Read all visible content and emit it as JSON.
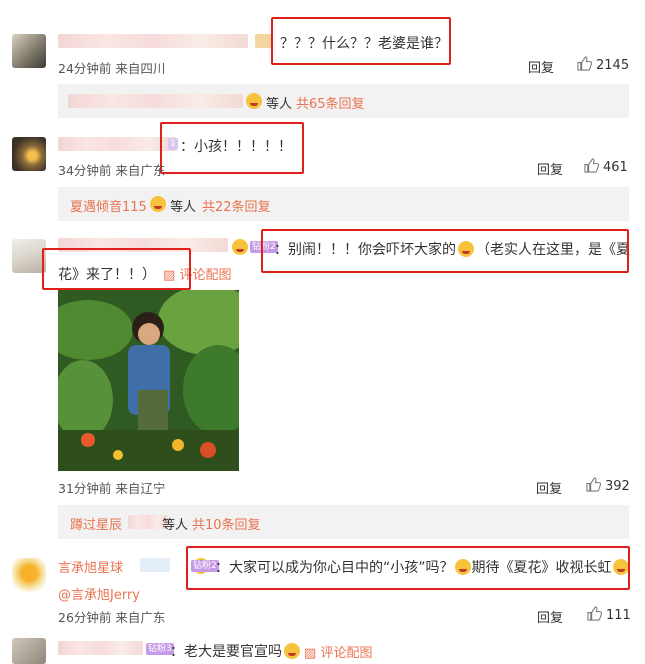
{
  "comments": [
    {
      "text": "？？？什么？？老婆是谁？",
      "meta": "24分钟前 来自四川",
      "reply": "回复",
      "likes": "2145",
      "sub": {
        "text": "等人",
        "count": "共65条回复"
      }
    },
    {
      "text": "：小孩！！！！！",
      "meta": "34分钟前 来自广东",
      "reply": "回复",
      "likes": "461",
      "sub": {
        "user": "夏遇倾音115",
        "text": "等人",
        "count": "共22条回复"
      }
    },
    {
      "badge": "钻粉2",
      "text": "：别闹！！！你会吓坏大家的",
      "text2": "（老实人在这里，是《夏",
      "text3": "花》来了！！）",
      "pic": "评论配图",
      "meta": "31分钟前 来自辽宁",
      "reply": "回复",
      "likes": "392",
      "sub": {
        "user": "蹲过星辰",
        "text": "等人",
        "count": "共10条回复"
      }
    },
    {
      "user": "言承旭星球",
      "badge": "钻粉2",
      "text": "：大家可以成为你心目中的“小孩”吗？",
      "text2": "期待《夏花》收视长虹",
      "mention": "@言承旭Jerry",
      "meta": "26分钟前 来自广东",
      "reply": "回复",
      "likes": "111"
    },
    {
      "badge": "钻粉3",
      "text": "：老大是要官宣吗",
      "pic": "评论配图"
    }
  ],
  "colors": {
    "accent": "#eb7350",
    "highlight": "#e0201a",
    "reply_bg": "#f2f2f2"
  }
}
